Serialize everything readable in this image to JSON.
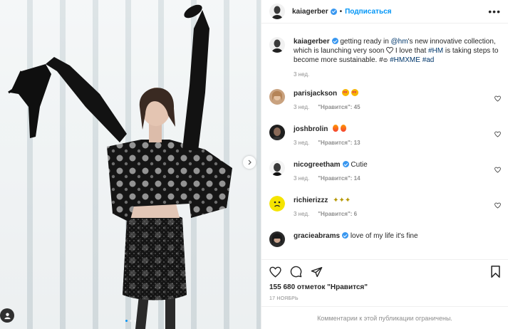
{
  "post": {
    "username": "kaiagerber",
    "header_bullet": "•",
    "follow_label": "Подписаться",
    "more_label": "•••",
    "caption": {
      "username": "kaiagerber",
      "t1": " getting ready in ",
      "mention": "@hm",
      "t2": "'s new innovative collection, which is launching very soon ",
      "t3": " I love that ",
      "tag1": "#HM",
      "t4": " is taking steps to become more sustainable. #",
      "t5": " ",
      "tag2": "#HMXME",
      "t6": " ",
      "tag3": "#ad",
      "time": "3 нед."
    },
    "comments": [
      {
        "username": "parisjackson",
        "text": "",
        "emoji": [
          "heart-eyes-emoji",
          "heart-eyes-emoji"
        ],
        "time": "3 нед.",
        "likes": "\"Нравится\": 45"
      },
      {
        "username": "joshbrolin",
        "text": "",
        "emoji": [
          "fire-emoji",
          "fire-emoji"
        ],
        "time": "3 нед.",
        "likes": "\"Нравится\": 13"
      },
      {
        "username": "nicogreetham",
        "text": "Cutie",
        "verified": true,
        "time": "3 нед.",
        "likes": "\"Нравится\": 14"
      },
      {
        "username": "richierizzz",
        "text": "",
        "emoji": [
          "sparkle-emoji",
          "sparkle-emoji",
          "sparkle-emoji"
        ],
        "time": "3 нед.",
        "likes": "\"Нравится\": 6"
      },
      {
        "username": "gracieabrams",
        "text": "love of my life it's fine",
        "verified": true
      }
    ],
    "likes_total": "155 680 отметок \"Нравится\"",
    "date": "17 НОЯБРЬ",
    "comments_closed": "Комментарии к этой публикации ограничены."
  },
  "colors": {
    "accent": "#0095f6",
    "verified": "#3897f0",
    "muted": "#8e8e8e",
    "hashtag": "#00376b"
  },
  "icons": {
    "carousel_next": "chevron-right-icon",
    "tag": "user-tag-icon",
    "like": "heart-icon",
    "comment": "comment-icon",
    "share": "paper-plane-icon",
    "save": "bookmark-icon"
  }
}
